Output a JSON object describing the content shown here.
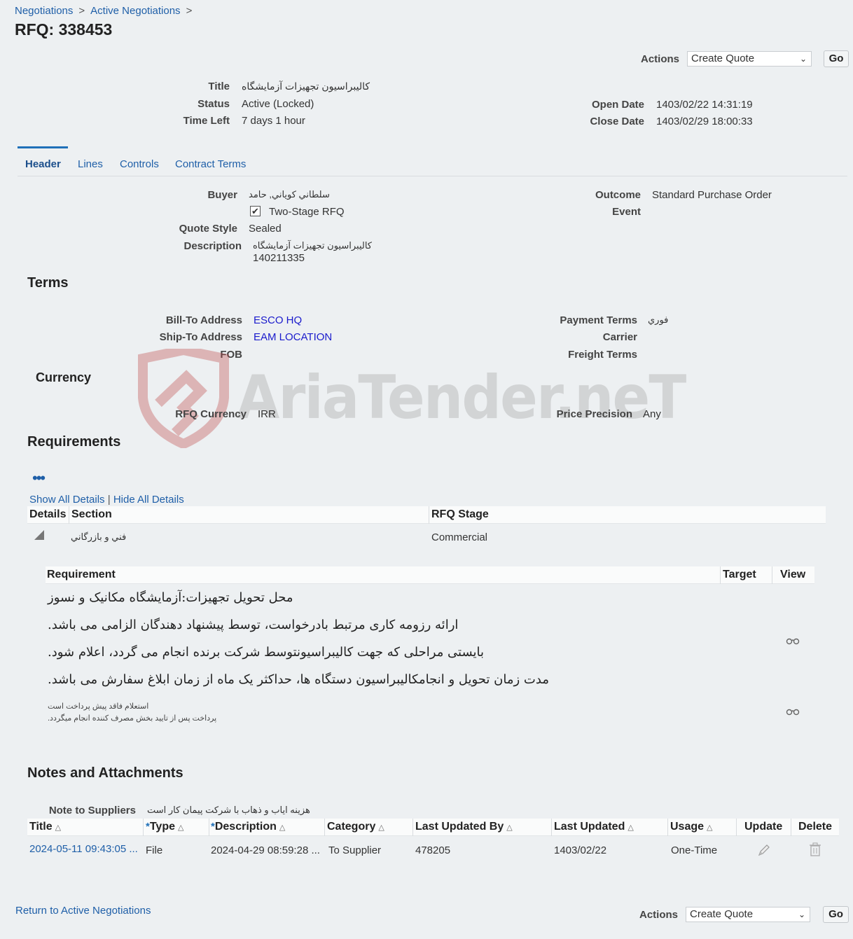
{
  "breadcrumb": {
    "items": [
      "Negotiations",
      "Active Negotiations"
    ],
    "sep": ">"
  },
  "page": {
    "title": "RFQ: 338453"
  },
  "actions": {
    "label": "Actions",
    "selected": "Create Quote",
    "go": "Go"
  },
  "summary": {
    "title_label": "Title",
    "title_value": "کالیبراسیون تجهیزات آزمایشگاه",
    "status_label": "Status",
    "status_value": "Active (Locked)",
    "time_left_label": "Time Left",
    "time_left_value": "7 days 1 hour",
    "open_date_label": "Open Date",
    "open_date_value": "1403/02/22 14:31:19",
    "close_date_label": "Close Date",
    "close_date_value": "1403/02/29 18:00:33"
  },
  "tabs": [
    "Header",
    "Lines",
    "Controls",
    "Contract Terms"
  ],
  "header": {
    "buyer_label": "Buyer",
    "buyer_value": "سلطاني كوياني, حامد",
    "two_stage_label": "Two-Stage RFQ",
    "two_stage_checked": true,
    "quote_style_label": "Quote Style",
    "quote_style_value": "Sealed",
    "description_label": "Description",
    "description_line1": "کالیبراسیون تجهیزات آزمایشگاه",
    "description_line2": "140211335",
    "outcome_label": "Outcome",
    "outcome_value": "Standard Purchase Order",
    "event_label": "Event"
  },
  "terms": {
    "heading": "Terms",
    "bill_to_label": "Bill-To Address",
    "bill_to_value": "ESCO HQ",
    "ship_to_label": "Ship-To Address",
    "ship_to_value": "EAM LOCATION",
    "fob_label": "FOB",
    "payment_terms_label": "Payment Terms",
    "payment_terms_value": "فوري",
    "carrier_label": "Carrier",
    "freight_terms_label": "Freight Terms"
  },
  "currency": {
    "heading": "Currency",
    "rfq_currency_label": "RFQ Currency",
    "rfq_currency_value": "IRR",
    "price_precision_label": "Price Precision",
    "price_precision_value": "Any"
  },
  "watermark": "AriaTender.neT",
  "requirements": {
    "heading": "Requirements",
    "show_all": "Show All Details",
    "divider": "|",
    "hide_all": "Hide All Details",
    "columns": [
      "Details",
      "Section",
      "RFQ Stage"
    ],
    "row": {
      "section": "فني و بازرگاني",
      "stage": "Commercial"
    },
    "sub_columns": [
      "Requirement",
      "Target",
      "View"
    ],
    "req1_lines": [
      "محل تحویل تجهیزات:آزمایشگاه مکانیک و نسوز",
      "ارائه رزومه کاری مرتبط بادرخواست، توسط پیشنهاد دهندگان الزامی می باشد.",
      "بایستی مراحلی که جهت کالیبراسیونتوسط شرکت برنده انجام می گردد، اعلام شود.",
      "مدت زمان تحویل و انجامکالیبراسیون دستگاه ها، حداکثر یک ماه از زمان ابلاغ سفارش می باشد."
    ],
    "req2_lines": [
      "استعلام فاقد پیش پرداخت است",
      "پرداخت پس از تایید بخش مصرف کننده انجام میگردد."
    ]
  },
  "notes": {
    "heading": "Notes and Attachments",
    "note_label": "Note to Suppliers",
    "note_value": "هزینه ایاب و ذهاب با شرکت پیمان کار است",
    "columns": [
      "Title",
      "Type",
      "Description",
      "Category",
      "Last Updated By",
      "Last Updated",
      "Usage",
      "Update",
      "Delete"
    ],
    "required_mark": "*",
    "row": {
      "title": "2024-05-11 09:43:05 ...",
      "type": "File",
      "description": "2024-04-29 08:59:28 ...",
      "category": "To Supplier",
      "updated_by": "478205",
      "updated": "1403/02/22",
      "usage": "One-Time"
    }
  },
  "footer": {
    "return_link": "Return to Active Negotiations"
  }
}
